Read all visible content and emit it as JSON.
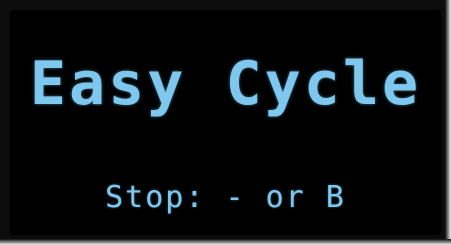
{
  "display": {
    "title": "Easy Cycle",
    "subtitle": "Stop: - or B",
    "text_color": "#7ec8f0",
    "background_color": "#000000"
  }
}
